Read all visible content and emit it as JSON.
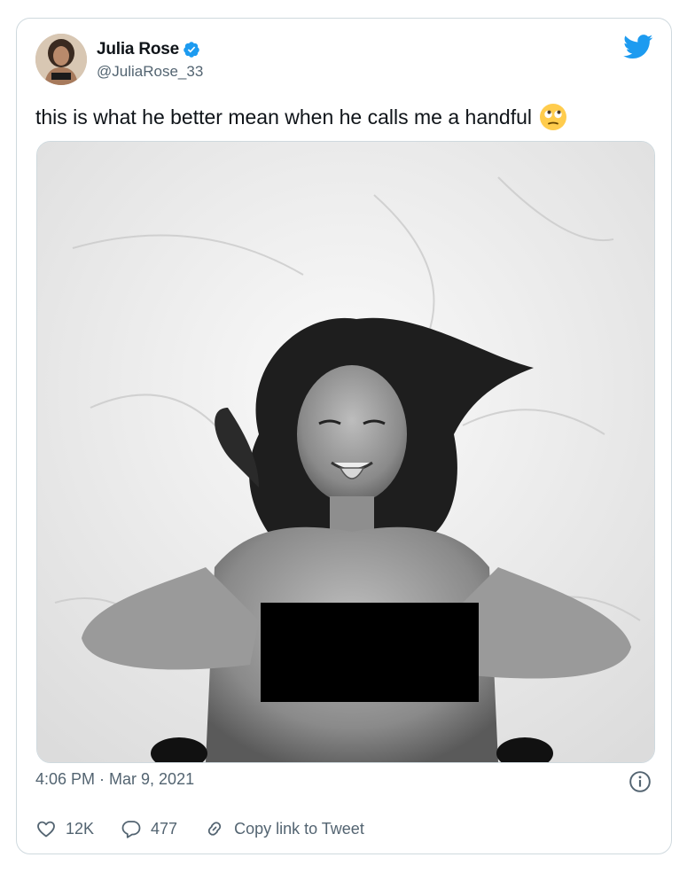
{
  "author": {
    "display_name": "Julia Rose",
    "handle": "@JuliaRose_33",
    "verified": true,
    "avatar_icon": "profile-photo"
  },
  "tweet": {
    "text": "this is what he better mean when he calls me a handful",
    "emoji": "rolling-eyes-emoji",
    "media": {
      "kind": "black-and-white photo",
      "censor_bar": true
    },
    "timestamp": "4:06 PM · Mar 9, 2021"
  },
  "actions": {
    "likes": "12K",
    "replies": "477",
    "copy_link": "Copy link to Tweet"
  },
  "colors": {
    "twitter_blue": "#1d9bf0",
    "text_primary": "#0f1419",
    "text_secondary": "#536471",
    "border": "#cfd9de",
    "censor": "#000000"
  }
}
